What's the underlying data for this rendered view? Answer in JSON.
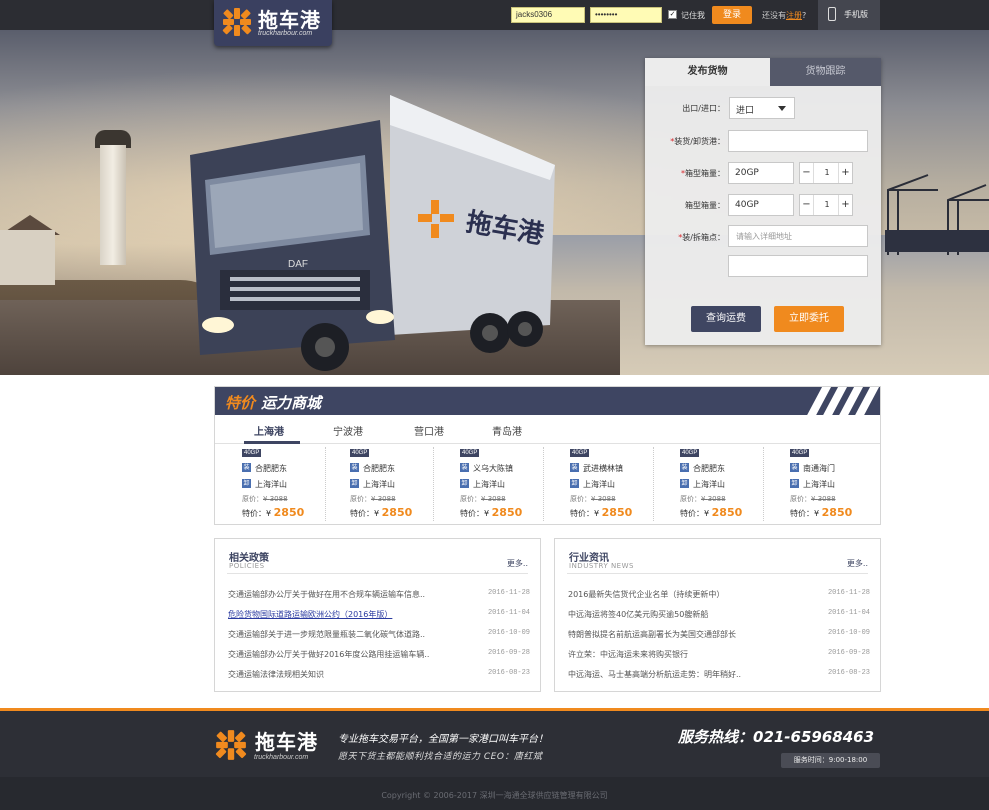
{
  "brand": {
    "name_cn": "拖车港",
    "name_en": "truckharbour.com",
    "orange": "#f08a1e",
    "navy": "#3e4562"
  },
  "topbar": {
    "username": "jacks0306",
    "password_mask": "••••••••",
    "remember_label": "记住我",
    "login_label": "登录",
    "no_account_text": "还没有",
    "register_label": "注册",
    "question_mark": "?",
    "mobile_label": "手机版"
  },
  "form": {
    "tab_publish": "发布货物",
    "tab_track": "货物跟踪",
    "import_export_label": "出口/进口：",
    "import_export_value": "进口",
    "port_label": "装货/卸货港：",
    "box_type_label": "箱型箱量：",
    "box_type_1": "20GP",
    "box_qty_1": "1",
    "box_type_2": "40GP",
    "box_qty_2": "1",
    "address_label": "装/拆箱点：",
    "address_placeholder": "请输入详细地址",
    "query_button": "查询运费",
    "commit_button": "立即委托"
  },
  "mall": {
    "title_a": "特价",
    "title_b": "运力商城",
    "tabs": [
      "上海港",
      "宁波港",
      "营口港",
      "青岛港"
    ],
    "orig_label": "原价：",
    "special_label": "特价：",
    "currency": "¥",
    "cards": [
      {
        "box": "40GP",
        "from": "合肥肥东",
        "to": "上海洋山",
        "orig": "3088",
        "price": "2850"
      },
      {
        "box": "40GP",
        "from": "合肥肥东",
        "to": "上海洋山",
        "orig": "3088",
        "price": "2850"
      },
      {
        "box": "40GP",
        "from": "义乌大陈镇",
        "to": "上海洋山",
        "orig": "3088",
        "price": "2850"
      },
      {
        "box": "40GP",
        "from": "武进横林镇",
        "to": "上海洋山",
        "orig": "3088",
        "price": "2850"
      },
      {
        "box": "40GP",
        "from": "合肥肥东",
        "to": "上海洋山",
        "orig": "3088",
        "price": "2850"
      },
      {
        "box": "40GP",
        "from": "南通海门",
        "to": "上海洋山",
        "orig": "3088",
        "price": "2850"
      }
    ],
    "from_icon": "装",
    "to_icon": "卸"
  },
  "policies": {
    "title_cn": "相关政策",
    "title_en": "POLICIES",
    "more": "更多..",
    "items": [
      {
        "title": "交通运输部办公厅关于做好在用不合规车辆运输车信息..",
        "date": "2016-11-28",
        "link": false
      },
      {
        "title": "危险货物国际道路运输欧洲公约（2016年版）",
        "date": "2016-11-04",
        "link": true
      },
      {
        "title": "交通运输部关于进一步规范限量瓶装二氧化碳气体道路..",
        "date": "2016-10-09",
        "link": false
      },
      {
        "title": "交通运输部办公厅关于做好2016年度公路甩挂运输车辆..",
        "date": "2016-09-28",
        "link": false
      },
      {
        "title": "交通运输法律法规相关知识",
        "date": "2016-08-23",
        "link": false
      }
    ]
  },
  "industry": {
    "title_cn": "行业资讯",
    "title_en": "INDUSTRY NEWS",
    "more": "更多..",
    "items": [
      {
        "title": "2016最新失信货代企业名单（持续更新中）",
        "date": "2016-11-28"
      },
      {
        "title": "中远海运将签40亿美元购买逾50艘新船",
        "date": "2016-11-04"
      },
      {
        "title": "特朗普拟提名前航运高副署长为美国交通部部长",
        "date": "2016-10-09"
      },
      {
        "title": "许立荣：中远海运未来将购买银行",
        "date": "2016-09-28"
      },
      {
        "title": "中远海运、马士基高端分析航运走势：明年稍好..",
        "date": "2016-08-23"
      }
    ]
  },
  "footer": {
    "slogan": "专业拖车交易平台，全国第一家港口叫车平台！",
    "slogan2": "愿天下货主都能顺利找合适的运力  CEO：唐红斌",
    "hotline": "服务热线：021-65968463",
    "service_time": "服务时间：9:00-18:00",
    "copyright": "Copyright © 2006-2017 深圳一海通全球供应链管理有限公司"
  }
}
